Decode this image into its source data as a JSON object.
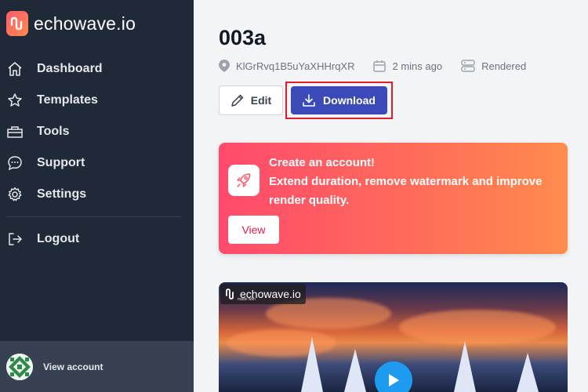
{
  "brand": {
    "name": "echowave.io",
    "accent": "#ff5a6e"
  },
  "sidebar": {
    "items": [
      {
        "label": "Dashboard",
        "icon": "home-icon"
      },
      {
        "label": "Templates",
        "icon": "star-icon"
      },
      {
        "label": "Tools",
        "icon": "toolbox-icon"
      },
      {
        "label": "Support",
        "icon": "chat-icon"
      },
      {
        "label": "Settings",
        "icon": "gear-icon"
      }
    ],
    "logout": {
      "label": "Logout",
      "icon": "logout-icon"
    },
    "account": {
      "label": "View account"
    }
  },
  "project": {
    "title": "003a",
    "id": "KlGrRvq1B5uYaXHHrqXR",
    "time": "2 mins ago",
    "status": "Rendered"
  },
  "actions": {
    "edit_label": "Edit",
    "download_label": "Download"
  },
  "promo": {
    "title": "Create an account!",
    "text": "Extend duration, remove watermark and improve render quality.",
    "button": "View"
  },
  "video": {
    "watermark": "echowave.io",
    "watermark_sub": "made with"
  }
}
